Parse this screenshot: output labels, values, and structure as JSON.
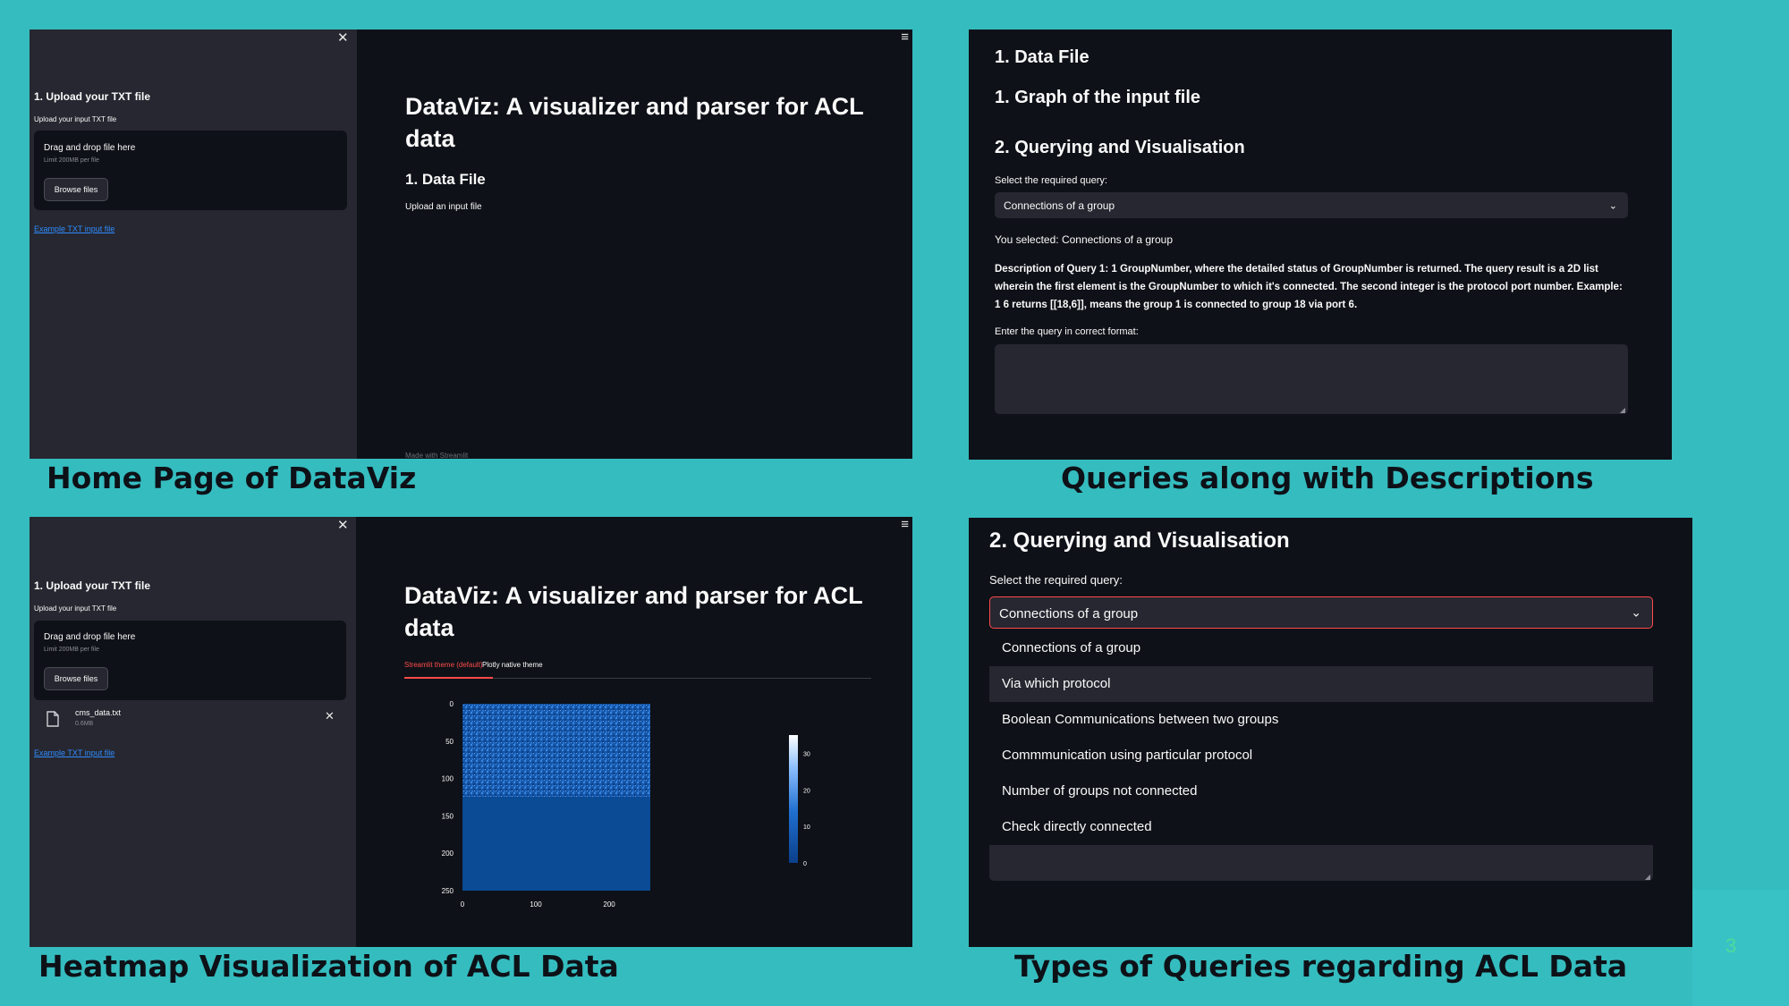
{
  "panel1": {
    "caption": "Home Page of DataViz",
    "sidebar": {
      "header": "1. Upload your TXT file",
      "upload_label": "Upload your input TXT file",
      "drop_text": "Drag and drop file here",
      "limit_text": "Limit 200MB per file",
      "browse_label": "Browse files",
      "example_link": "Example TXT input file"
    },
    "main": {
      "title": "DataViz: A visualizer and parser for ACL data",
      "section": "1. Data File",
      "instruction": "Upload an input file",
      "footer": "Made with Streamlit"
    }
  },
  "panel2": {
    "caption": "Queries along with Descriptions",
    "h_data_file": "1. Data File",
    "h_graph": "1. Graph of the input file",
    "h_query": "2. Querying and Visualisation",
    "select_label": "Select the required query:",
    "selected_value": "Connections of a group",
    "you_selected": "You selected: Connections of a group",
    "description": "Description of Query 1: 1 GroupNumber, where the detailed status of GroupNumber is returned. The query result is a 2D list wherein the first element is the GroupNumber to which it's connected. The second integer is the protocol port number. Example: 1 6 returns [[18,6]], means the group 1 is connected to group 18 via port 6.",
    "input_label": "Enter the query in correct format:"
  },
  "panel3": {
    "caption": "Heatmap Visualization of ACL Data",
    "sidebar": {
      "header": "1. Upload your TXT file",
      "upload_label": "Upload your input TXT file",
      "drop_text": "Drag and drop file here",
      "limit_text": "Limit 200MB per file",
      "browse_label": "Browse files",
      "file_name": "cms_data.txt",
      "file_size": "0.6MB",
      "example_link": "Example TXT input file"
    },
    "main": {
      "title": "DataViz: A visualizer and parser for ACL data",
      "tabs": [
        "Streamlit theme (default)",
        "Plotly native theme"
      ],
      "active_tab": 0
    },
    "chart_data": {
      "type": "heatmap",
      "x_ticks": [
        "0",
        "100",
        "200"
      ],
      "y_ticks": [
        "0",
        "50",
        "100",
        "150",
        "200",
        "250"
      ],
      "colorbar_ticks": [
        "0",
        "10",
        "20",
        "30"
      ],
      "colorscale": [
        "#0b3f8a",
        "#1f6fd0",
        "#8fc1ff",
        "#ffffff"
      ]
    }
  },
  "panel4": {
    "caption": "Types of Queries regarding ACL Data",
    "heading": "2. Querying and Visualisation",
    "select_label": "Select the required query:",
    "selected_value": "Connections of a group",
    "options": [
      "Connections of a group",
      "Via which protocol",
      "Boolean Communications between two groups",
      "Commmunication using particular protocol",
      "Number of groups not connected",
      "Check directly connected"
    ],
    "highlighted_index": 1
  },
  "slide_number": "3",
  "colors": {
    "background": "#35bcbf",
    "streamlit_dark": "#0e1117",
    "sidebar": "#262730",
    "accent_red": "#ff4b4b"
  }
}
